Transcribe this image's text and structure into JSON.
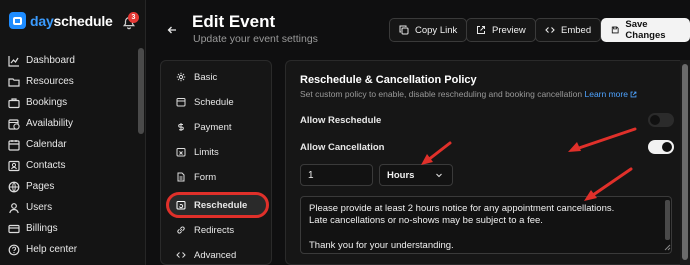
{
  "brand": {
    "name_prefix": "day",
    "name_suffix": "schedule"
  },
  "notifications": {
    "count": "3"
  },
  "sidebar": {
    "items": [
      {
        "label": "Dashboard",
        "icon": "chart-line-icon"
      },
      {
        "label": "Resources",
        "icon": "folder-icon"
      },
      {
        "label": "Bookings",
        "icon": "briefcase-icon"
      },
      {
        "label": "Availability",
        "icon": "calendar-clock-icon"
      },
      {
        "label": "Calendar",
        "icon": "calendar-icon"
      },
      {
        "label": "Contacts",
        "icon": "contact-card-icon"
      },
      {
        "label": "Pages",
        "icon": "globe-icon"
      },
      {
        "label": "Users",
        "icon": "user-icon"
      },
      {
        "label": "Billings",
        "icon": "credit-card-icon"
      },
      {
        "label": "Help center",
        "icon": "help-circle-icon"
      }
    ]
  },
  "header": {
    "title": "Edit Event",
    "subtitle": "Update your event settings",
    "copy_link": "Copy Link",
    "preview": "Preview",
    "embed": "Embed",
    "save": "Save Changes"
  },
  "tabs": [
    {
      "label": "Basic",
      "icon": "gear-icon"
    },
    {
      "label": "Schedule",
      "icon": "calendar-icon"
    },
    {
      "label": "Payment",
      "icon": "dollar-icon"
    },
    {
      "label": "Limits",
      "icon": "calendar-x-icon"
    },
    {
      "label": "Form",
      "icon": "document-icon"
    },
    {
      "label": "Reschedule",
      "icon": "calendar-refresh-icon",
      "active": true
    },
    {
      "label": "Redirects",
      "icon": "link-icon"
    },
    {
      "label": "Advanced",
      "icon": "code-icon"
    }
  ],
  "policy": {
    "title": "Reschedule & Cancellation Policy",
    "description": "Set custom policy to enable, disable rescheduling and booking cancellation",
    "learn_more": "Learn more",
    "allow_reschedule": {
      "label": "Allow Reschedule",
      "enabled": false
    },
    "allow_cancellation": {
      "label": "Allow Cancellation",
      "enabled": true
    },
    "notice_value": "1",
    "notice_unit": "Hours",
    "message_lines": [
      "Please provide at least 2 hours notice for any appointment cancellations.",
      "Late cancellations or no-shows may be subject to a fee.",
      "",
      "Thank you for your understanding."
    ]
  },
  "colors": {
    "accent": "#1e8cff",
    "annotation_red": "#e0302a",
    "background": "#0f0f10"
  }
}
